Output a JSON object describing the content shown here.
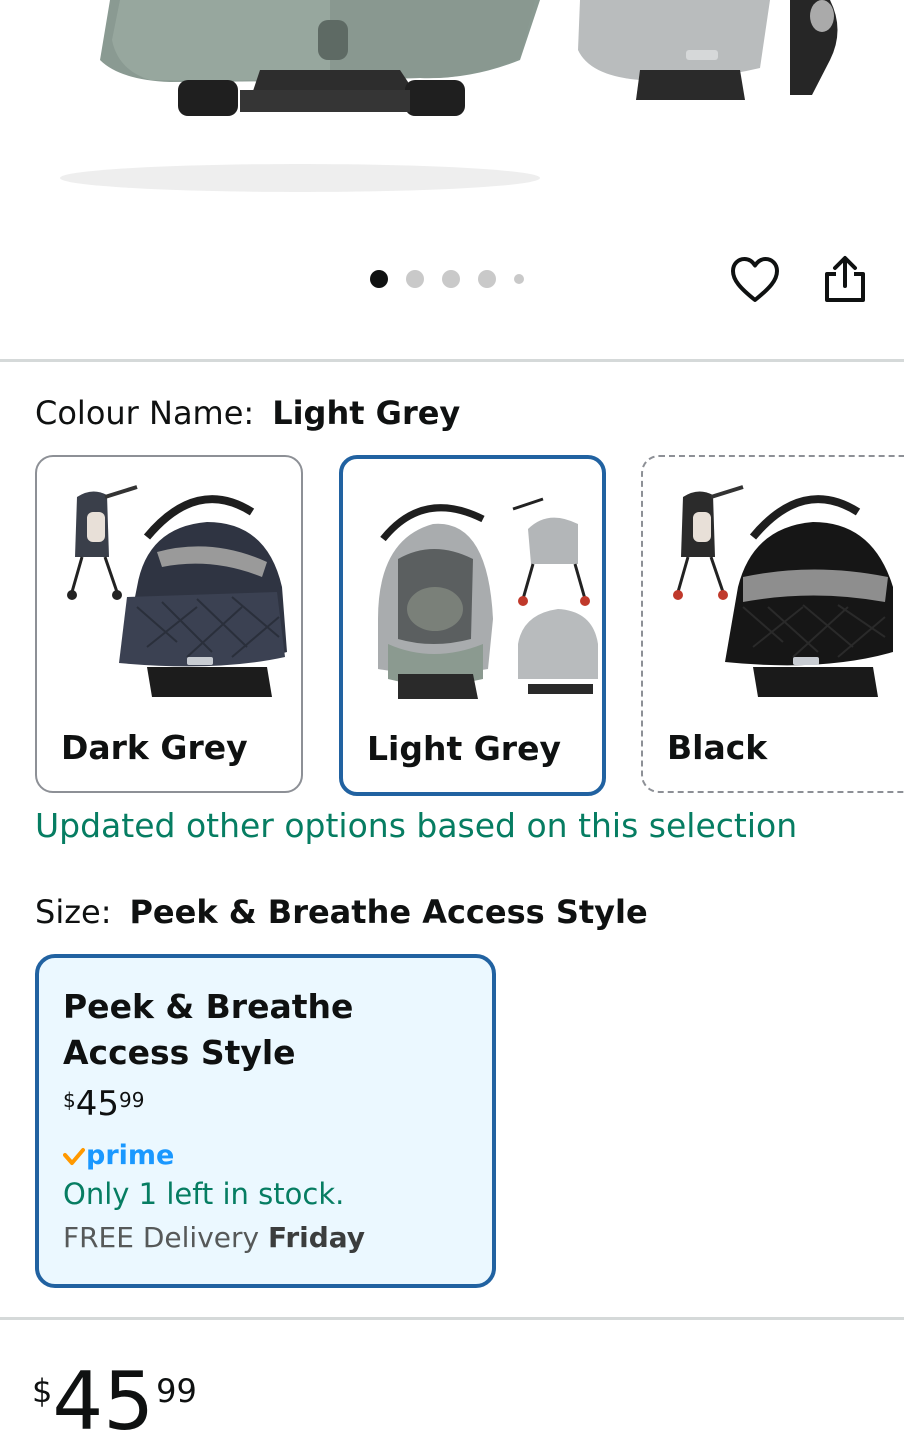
{
  "gallery": {
    "dot_count": 5,
    "active_dot": 0
  },
  "colour": {
    "label": "Colour Name:",
    "selected_value": "Light Grey",
    "options": [
      {
        "label": "Dark Grey"
      },
      {
        "label": "Light Grey"
      },
      {
        "label": "Black"
      }
    ],
    "updated_message": "Updated other options based on this selection"
  },
  "size": {
    "label": "Size:",
    "selected_value": "Peek & Breathe Access Style",
    "card": {
      "title": "Peek & Breathe Access Style",
      "price_symbol": "$",
      "price_whole": "45",
      "price_fraction": "99",
      "prime_label": "prime",
      "stock": "Only 1 left in stock.",
      "delivery_prefix": "FREE Delivery",
      "delivery_day": "Friday"
    }
  },
  "price": {
    "symbol": "$",
    "whole": "45",
    "fraction": "99"
  },
  "colors": {
    "accent_blue": "#2162a1",
    "success_green": "#067d62",
    "prime_blue": "#1a98ff",
    "prime_orange": "#ff9900",
    "selected_bg": "#ebf8ff"
  },
  "icons": {
    "wishlist": "heart-icon",
    "share": "share-icon",
    "prime_check": "check-icon"
  }
}
